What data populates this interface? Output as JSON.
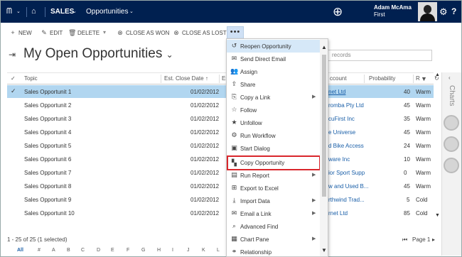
{
  "nav": {
    "app": "SALES",
    "area": "Opportunities",
    "user_name": "Adam McAma",
    "user_org": "First"
  },
  "toolbar": {
    "new": "NEW",
    "edit": "EDIT",
    "delete": "DELETE",
    "close_won": "CLOSE AS WON",
    "close_lost": "CLOSE AS LOST",
    "more": "•••"
  },
  "view": {
    "title": "My Open Opportunities",
    "search_placeholder": "records"
  },
  "grid": {
    "columns": [
      "Topic",
      "Est. Close Date",
      "Es",
      "ccount",
      "Probability",
      "R"
    ],
    "rows": [
      {
        "topic": "Sales Opportunit 1",
        "date": "01/02/2012",
        "account": "net Ltd",
        "prob": "40",
        "rating": "Warm"
      },
      {
        "topic": "Sales Opportunit 2",
        "date": "01/02/2012",
        "account": "romba Pty Ltd",
        "prob": "45",
        "rating": "Warm"
      },
      {
        "topic": "Sales Opportunit 3",
        "date": "01/02/2012",
        "account": "cuFirst Inc",
        "prob": "35",
        "rating": "Warm"
      },
      {
        "topic": "Sales Opportunit 4",
        "date": "01/02/2012",
        "account": "e Universe",
        "prob": "45",
        "rating": "Warm"
      },
      {
        "topic": "Sales Opportunit 5",
        "date": "01/02/2012",
        "account": "d Bike Access",
        "prob": "24",
        "rating": "Warm"
      },
      {
        "topic": "Sales Opportunit 6",
        "date": "01/02/2012",
        "account": "ware Inc",
        "prob": "10",
        "rating": "Warm"
      },
      {
        "topic": "Sales Opportunit 7",
        "date": "01/02/2012",
        "account": "ior Sport Supp",
        "prob": "0",
        "rating": "Warm"
      },
      {
        "topic": "Sales Opportunit 8",
        "date": "01/02/2012",
        "account": "w and Used B...",
        "prob": "45",
        "rating": "Warm"
      },
      {
        "topic": "Sales Opportunit 9",
        "date": "01/02/2012",
        "account": "rthwind Trad...",
        "prob": "5",
        "rating": "Cold"
      },
      {
        "topic": "Sales Opportunit 10",
        "date": "01/02/2012",
        "account": "rnet Ltd",
        "prob": "85",
        "rating": "Cold"
      }
    ],
    "footer_count": "1 - 25 of 25 (1 selected)",
    "page": "Page 1",
    "alphabet": [
      "All",
      "#",
      "A",
      "B",
      "C",
      "D",
      "E",
      "F",
      "G",
      "H",
      "I",
      "J",
      "K",
      "L"
    ]
  },
  "menu": {
    "items": [
      {
        "label": "Reopen Opportunity",
        "icon": "reopen-icon"
      },
      {
        "label": "Send Direct Email",
        "icon": "email-icon"
      },
      {
        "label": "Assign",
        "icon": "assign-icon"
      },
      {
        "label": "Share",
        "icon": "share-icon"
      },
      {
        "label": "Copy a Link",
        "icon": "link-icon"
      },
      {
        "label": "Follow",
        "icon": "star-outline-icon"
      },
      {
        "label": "Unfollow",
        "icon": "star-filled-icon"
      },
      {
        "label": "Run Workflow",
        "icon": "workflow-icon"
      },
      {
        "label": "Start Dialog",
        "icon": "dialog-icon"
      },
      {
        "label": "Copy Opportunity",
        "icon": "copy-icon"
      },
      {
        "label": "Run Report",
        "icon": "report-icon"
      },
      {
        "label": "Export to Excel",
        "icon": "excel-icon"
      },
      {
        "label": "Import Data",
        "icon": "import-icon"
      },
      {
        "label": "Email a Link",
        "icon": "email-link-icon"
      },
      {
        "label": "Advanced Find",
        "icon": "advanced-find-icon"
      },
      {
        "label": "Chart Pane",
        "icon": "chart-pane-icon"
      },
      {
        "label": "Relationship",
        "icon": "relationship-icon"
      }
    ]
  },
  "side": {
    "charts": "Charts"
  },
  "colors": {
    "nav_bg": "#002050",
    "selected_row": "#b1d6f0",
    "highlight": "#d9262c"
  }
}
